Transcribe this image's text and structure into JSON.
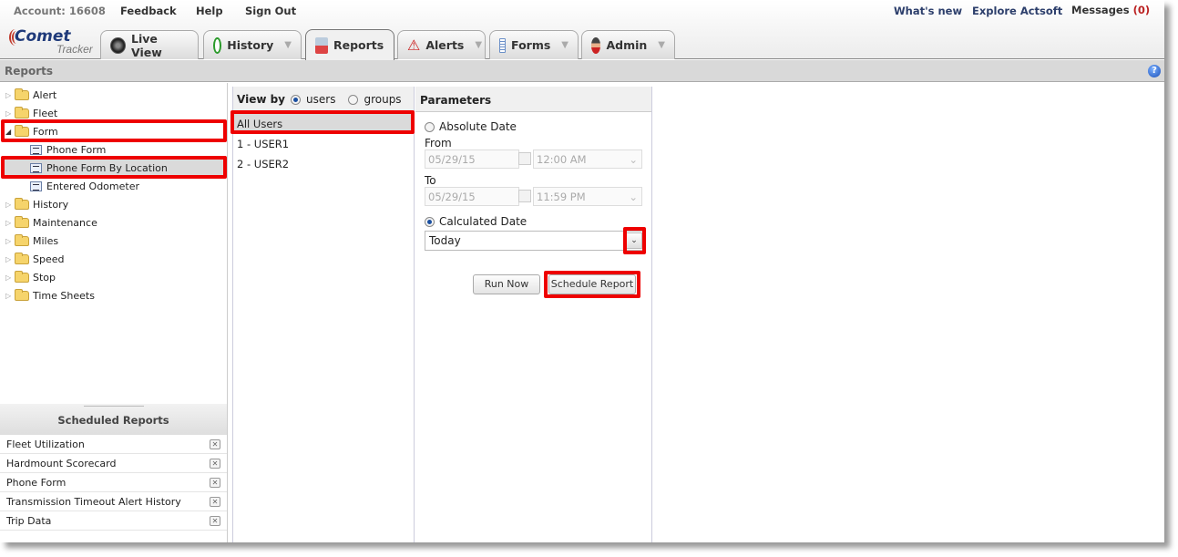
{
  "header": {
    "account": "Account: 16608",
    "feedback": "Feedback",
    "help": "Help",
    "sign_out": "Sign Out",
    "whats_new": "What's new",
    "explore": "Explore Actsoft",
    "messages_label": "Messages",
    "messages_count": "(0)",
    "logo_main": "Comet",
    "logo_sub": "Tracker"
  },
  "tabs": [
    {
      "label": "Live View",
      "icon": "speedometer-icon",
      "dropdown": false
    },
    {
      "label": "History",
      "icon": "clock-icon",
      "dropdown": true
    },
    {
      "label": "Reports",
      "icon": "report-icon",
      "dropdown": false,
      "active": true
    },
    {
      "label": "Alerts",
      "icon": "warning-icon",
      "dropdown": true
    },
    {
      "label": "Forms",
      "icon": "document-icon",
      "dropdown": true
    },
    {
      "label": "Admin",
      "icon": "user-icon",
      "dropdown": true
    }
  ],
  "section_title": "Reports",
  "tree": [
    {
      "label": "Alert",
      "type": "folder",
      "expanded": false
    },
    {
      "label": "Fleet",
      "type": "folder",
      "expanded": false
    },
    {
      "label": "Form",
      "type": "folder",
      "expanded": true
    },
    {
      "label": "Phone Form",
      "type": "report"
    },
    {
      "label": "Phone Form By Location",
      "type": "report",
      "selected": true
    },
    {
      "label": "Entered Odometer",
      "type": "report"
    },
    {
      "label": "History",
      "type": "folder",
      "expanded": false
    },
    {
      "label": "Maintenance",
      "type": "folder",
      "expanded": false
    },
    {
      "label": "Miles",
      "type": "folder",
      "expanded": false
    },
    {
      "label": "Speed",
      "type": "folder",
      "expanded": false
    },
    {
      "label": "Stop",
      "type": "folder",
      "expanded": false
    },
    {
      "label": "Time Sheets",
      "type": "folder",
      "expanded": false
    }
  ],
  "scheduled": {
    "title": "Scheduled Reports",
    "items": [
      "Fleet Utilization",
      "Hardmount Scorecard",
      "Phone Form",
      "Transmission Timeout Alert History",
      "Trip Data"
    ]
  },
  "view_by": {
    "label": "View by",
    "options": [
      "users",
      "groups"
    ],
    "selected": "users",
    "items": [
      "All Users",
      "1 - USER1",
      "2 - USER2"
    ],
    "selected_item": "All Users"
  },
  "parameters": {
    "title": "Parameters",
    "absolute_label": "Absolute Date",
    "from_label": "From",
    "from_date": "05/29/15",
    "from_time": "12:00 AM",
    "to_label": "To",
    "to_date": "05/29/15",
    "to_time": "11:59 PM",
    "calculated_label": "Calculated Date",
    "calculated_value": "Today",
    "run_now": "Run Now",
    "schedule_report": "Schedule Report"
  }
}
